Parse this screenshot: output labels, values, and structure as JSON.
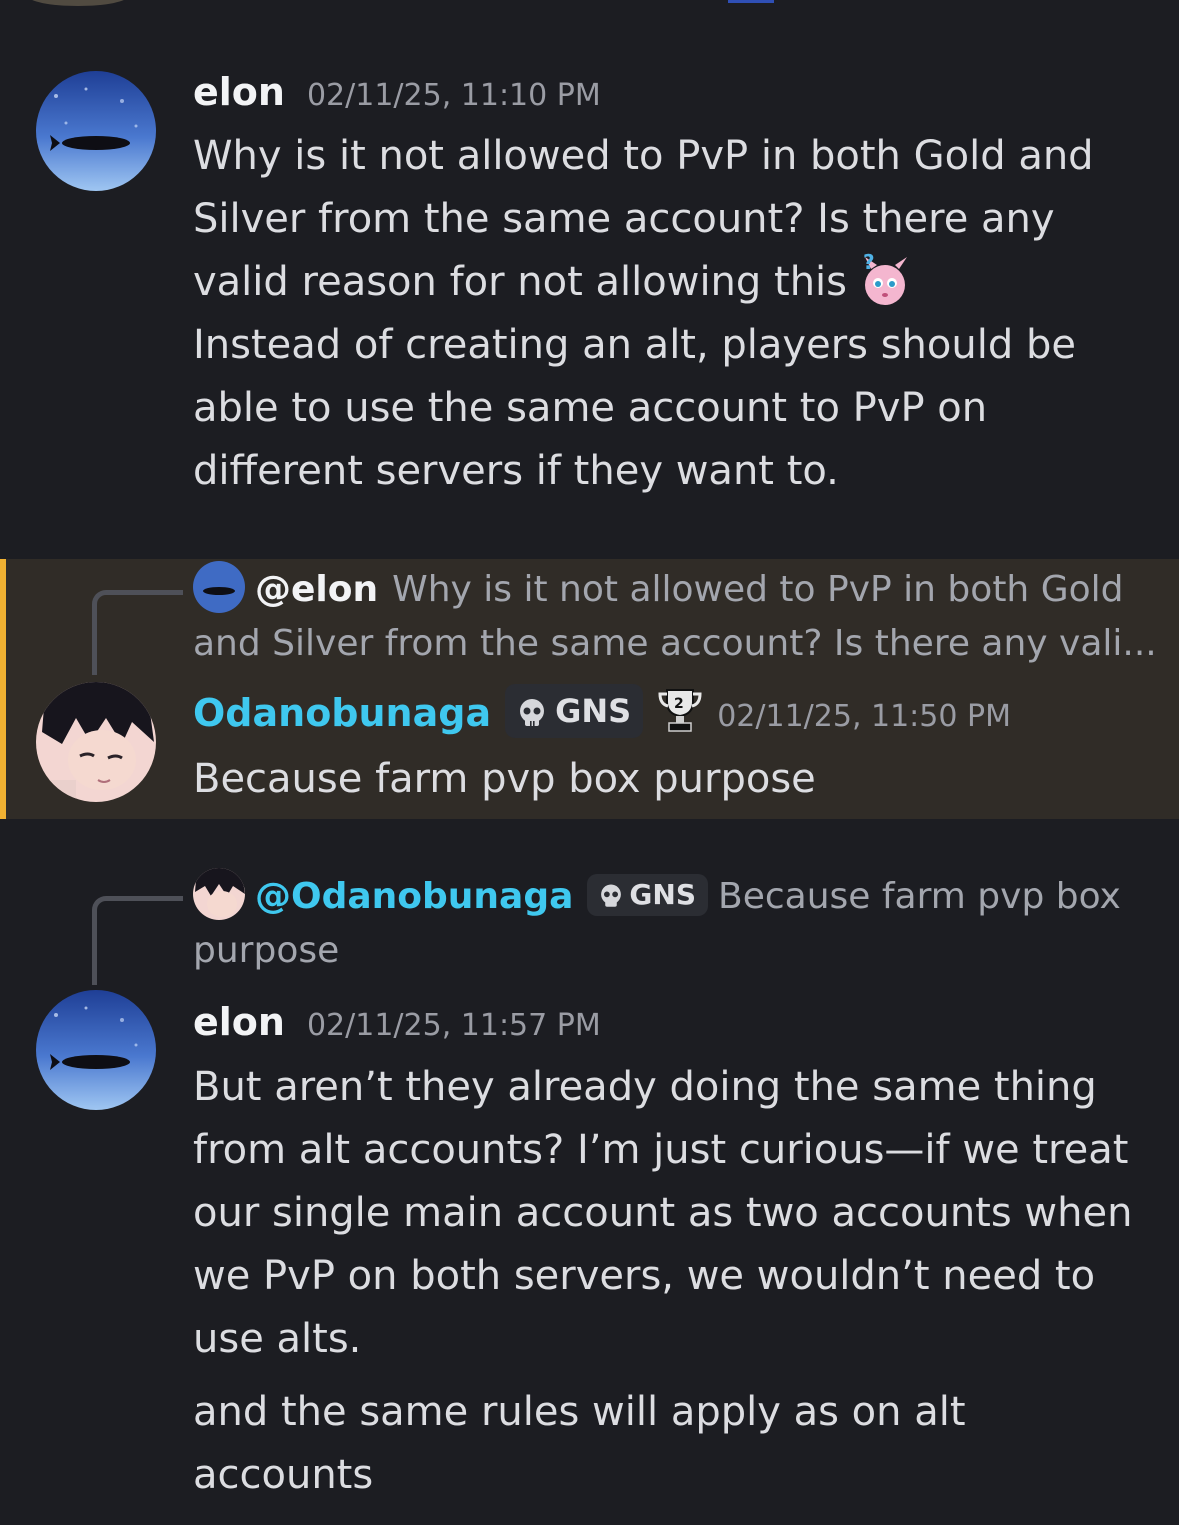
{
  "messages": [
    {
      "author": "elon",
      "timestamp": "02/11/25, 11:10 PM",
      "lines": [
        "Why is it not allowed to PvP in both Gold and",
        "Silver from the same account? Is there any",
        "valid reason for not allowing this",
        "Instead of creating an alt, players should be",
        "able to use the same account to PvP on",
        "different servers if they want to."
      ],
      "emoji": "confused-jigglypuff-emoji"
    },
    {
      "reply": {
        "mention": "@elon",
        "preview_line1": "Why is it not allowed to PvP in both Gold",
        "preview_line2": "and Silver from the same account? Is there any vali..."
      },
      "author": "Odanobunaga",
      "tag": "GNS",
      "timestamp": "02/11/25, 11:50 PM",
      "text": "Because farm pvp box purpose",
      "highlight_color": "#f0b132"
    },
    {
      "reply": {
        "mention": "@Odanobunaga",
        "tag": "GNS",
        "preview_line1": "Because farm pvp box",
        "preview_line2": "purpose"
      },
      "author": "elon",
      "timestamp": "02/11/25, 11:57 PM",
      "lines": [
        "But aren’t they already doing the same thing",
        "from alt accounts? I’m just curious—if we treat",
        "our single main account as two accounts when",
        "we PvP on both servers, we wouldn’t need to",
        "use alts."
      ],
      "followup_lines": [
        "and the same rules will apply as on alt",
        "accounts"
      ]
    }
  ],
  "icons": {
    "tag_icon": "skull-icon",
    "badge_icon": "trophy-icon"
  },
  "colors": {
    "background": "#1c1d22",
    "mention_cyan": "#3fc8ef",
    "highlight_bg": "#302c27",
    "highlight_bar": "#f0b132"
  }
}
